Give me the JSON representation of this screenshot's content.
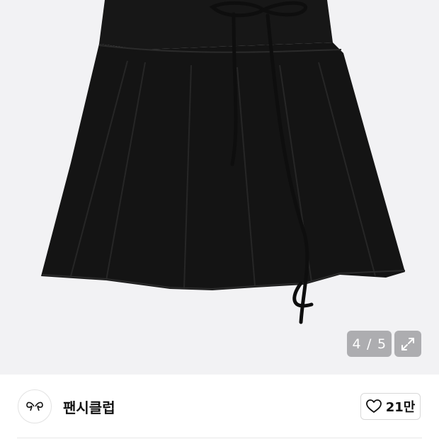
{
  "gallery": {
    "image": "black-pleated-skirt-photo",
    "counter": {
      "current": "4",
      "separator": "/",
      "total": "5"
    },
    "expand_icon": "expand-icon"
  },
  "shop": {
    "logo_icon": "shop-logo-icon",
    "name": "팬시클럽",
    "like": {
      "icon": "heart-outline-icon",
      "count": "21만"
    }
  },
  "colors": {
    "gallery_bg": "#f2f2f4",
    "skirt": "#141414",
    "overlay": "#8a8a8e"
  }
}
